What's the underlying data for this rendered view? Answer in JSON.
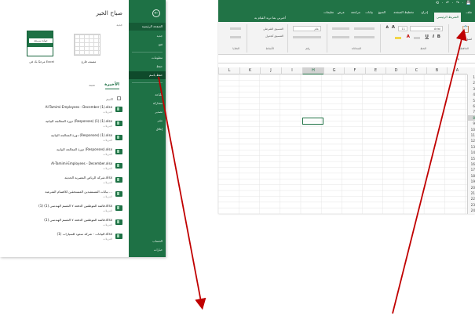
{
  "backstage": {
    "greeting": "صباح الخير",
    "new_label": "جديد",
    "templates": [
      {
        "hint": "جولة سريعة",
        "label": "مرحبًا بك في Excel"
      },
      {
        "label": "مصنف فارغ"
      }
    ],
    "tabs": {
      "recent": "الأخيرة",
      "pinned": "مثبتة"
    },
    "name_header": "الاسم",
    "files": [
      {
        "name": "Al-Tamimi-Employees - December (1).xlsx",
        "path": "التنزيلات"
      },
      {
        "name": "دورة المعالجة البيانية (Responses) (1) (1).xlsx",
        "path": "التنزيلات"
      },
      {
        "name": "دورة المعالجة البيانية (Responses) (1).xlsx",
        "path": "التنزيلات"
      },
      {
        "name": "دورة المعالجة البيانية (Responses).xlsx",
        "path": "التنزيلات"
      },
      {
        "name": "Al-Tamimi-Employees - December.xlsx",
        "path": "التنزيلات"
      },
      {
        "name": "شركة الرياض المصرية الحديثة.xlsx",
        "path": "التنزيلات"
      },
      {
        "name": "بيانات المستفيدين المستحقين للاقسام الشرعية ...",
        "path": "التنزيلات"
      },
      {
        "name": "قائمة الموظفين الدفعة ٧ القسم الهندسي (1) (1).xlsx",
        "path": "التنزيلات"
      },
      {
        "name": "قائمة الموظفين الدفعة ٧ القسم الهندسي (1).xlsx",
        "path": "التنزيلات"
      },
      {
        "name": "البيانات - شركة سعود للسيارات (1).xlsx",
        "path": "التنزيلات"
      }
    ],
    "nav": {
      "back": "←",
      "home": "الصفحة الرئيسية",
      "new": "جديد",
      "open": "فتح",
      "info": "معلومات",
      "save": "حفظ",
      "save_as": "حفظ باسم",
      "print": "طباعة",
      "share": "مشاركة",
      "export": "تصدير",
      "publish": "نشر",
      "close": "إغلاق",
      "account": "الحساب",
      "options": "خيارات"
    },
    "colors": {
      "nav_green": "#1e7145"
    }
  },
  "excel": {
    "qat": "⟲ · ↶ · ↷ · 💾",
    "tabs": [
      "ملف",
      "الشريط الرئيسي",
      "إدراج",
      "تخطيط الصفحة",
      "الصيغ",
      "بيانات",
      "مراجعة",
      "عرض",
      "تعليمات"
    ],
    "tell_me": "أخبرني بما تريد القيام به",
    "ribbon": {
      "font_name": "Arial",
      "font_size": "11",
      "groups": [
        "الحافظة",
        "الخط",
        "المحاذاة",
        "رقم",
        "الأنماط",
        "الخلايا",
        "التحرير"
      ],
      "format": "عام",
      "conditional": "التنسيق الشرطي",
      "format_table": "التنسيق كجدول",
      "paste": "لصق"
    },
    "columns": [
      "L",
      "K",
      "J",
      "I",
      "H",
      "G",
      "F",
      "E",
      "D",
      "C",
      "B",
      "A"
    ],
    "selected_column": "H",
    "rows": [
      "1",
      "2",
      "3",
      "4",
      "5",
      "6",
      "7",
      "8",
      "9",
      "10",
      "11",
      "12",
      "13",
      "14",
      "15",
      "16",
      "17",
      "18",
      "19",
      "20",
      "21",
      "22",
      "23",
      "24"
    ],
    "selected_row": "8",
    "colors": {
      "excel_green": "#217346"
    }
  },
  "arrows": {
    "color": "#c00000"
  }
}
